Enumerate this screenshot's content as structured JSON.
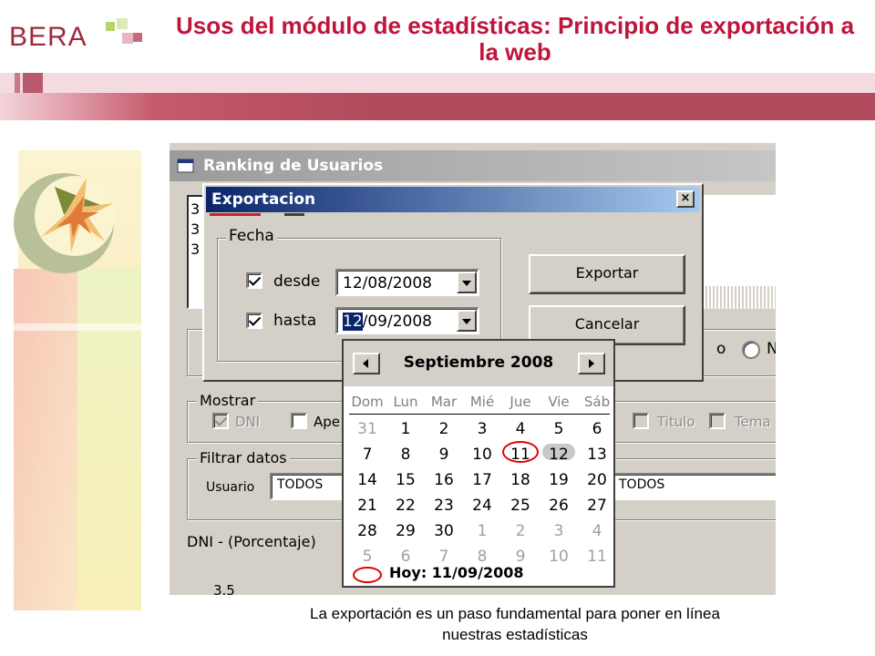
{
  "logo": {
    "text": "BERA"
  },
  "slide": {
    "title": "Usos del módulo de estadísticas: Principio de exportación a la web",
    "caption_line1": "La exportación es un paso fundamental para poner en línea",
    "caption_line2": "nuestras estadísticas"
  },
  "ranking_window": {
    "title": "Ranking de Usuarios",
    "list_items": [
      "3",
      "3",
      "3"
    ],
    "radio_label_partial": "o",
    "radio2_label_partial": "N",
    "mostrar": {
      "label": "Mostrar",
      "dni": "DNI",
      "ape": "Ape",
      "titulo": "Titulo",
      "tema": "Tema"
    },
    "filtrar": {
      "label": "Filtrar datos",
      "usuario_label": "Usuario",
      "usuario_value": "TODOS",
      "second_value": "TODOS"
    },
    "dni_label": "DNI -  (Porcentaje)",
    "axis_value": "3.5"
  },
  "export_dialog": {
    "title": "Exportacion",
    "close_glyph": "×",
    "fecha_group": "Fecha",
    "desde_label": "desde",
    "desde_value": "12/08/2008",
    "hasta_label": "hasta",
    "hasta_value_selected": "12",
    "hasta_value_rest": "/09/2008",
    "exportar_button": "Exportar",
    "cancelar_button": "Cancelar"
  },
  "calendar": {
    "month": "Septiembre 2008",
    "weekdays": [
      "Dom",
      "Lun",
      "Mar",
      "Mié",
      "Jue",
      "Vie",
      "Sáb"
    ],
    "weeks": [
      [
        "31",
        "1",
        "2",
        "3",
        "4",
        "5",
        "6"
      ],
      [
        "7",
        "8",
        "9",
        "10",
        "11",
        "12",
        "13"
      ],
      [
        "14",
        "15",
        "16",
        "17",
        "18",
        "19",
        "20"
      ],
      [
        "21",
        "22",
        "23",
        "24",
        "25",
        "26",
        "27"
      ],
      [
        "28",
        "29",
        "30",
        "1",
        "2",
        "3",
        "4"
      ],
      [
        "5",
        "6",
        "7",
        "8",
        "9",
        "10",
        "11"
      ]
    ],
    "today_label": "Hoy: 11/09/2008"
  },
  "colors": {
    "title_red": "#c0143c",
    "band": "#b04a5c",
    "win_blue": "#0a246a",
    "circle_red": "#e00000"
  }
}
